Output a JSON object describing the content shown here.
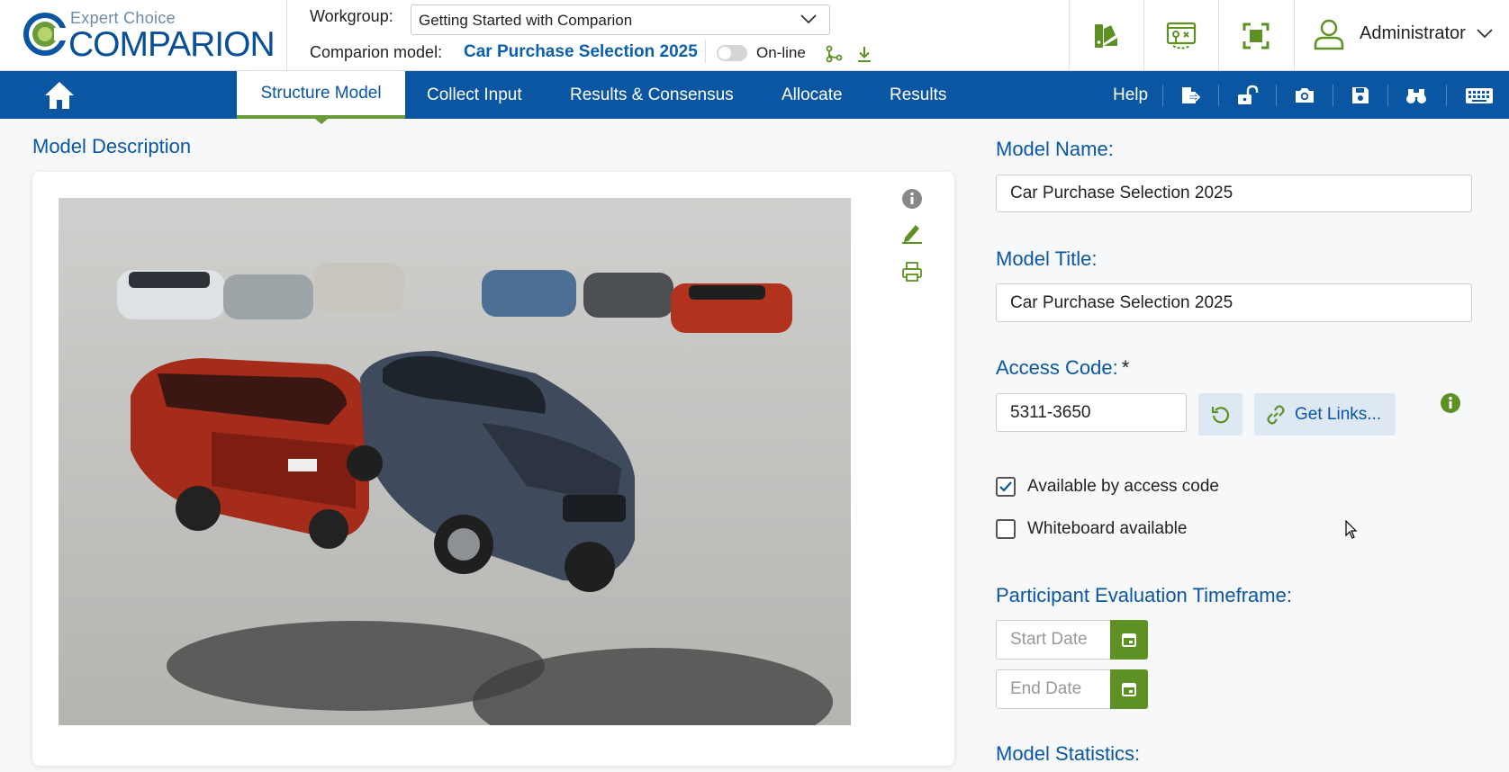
{
  "brand": {
    "small": "Expert Choice",
    "big": "COMPARION",
    "colors": {
      "primary": "#0a56a3",
      "accent_green": "#5e9123"
    }
  },
  "header": {
    "workgroup_label": "Workgroup:",
    "workgroup_value": "Getting Started with Comparion",
    "model_label": "Comparion model:",
    "model_name": "Car Purchase Selection 2025",
    "online_label": "On-line",
    "online_enabled": false,
    "toolbar_icons": [
      "palette-icon",
      "map-icon",
      "fullscreen-icon"
    ],
    "user_name": "Administrator"
  },
  "nav": {
    "tabs": [
      {
        "label": "Structure Model",
        "active": true
      },
      {
        "label": "Collect Input",
        "active": false
      },
      {
        "label": "Results & Consensus",
        "active": false
      },
      {
        "label": "Allocate",
        "active": false
      },
      {
        "label": "Results",
        "active": false
      }
    ],
    "help": "Help",
    "icons": [
      "export-icon",
      "unlock-icon",
      "camera-icon",
      "save-icon",
      "binoculars-icon",
      "keyboard-icon"
    ]
  },
  "description": {
    "title": "Model Description"
  },
  "form": {
    "model_name_label": "Model Name:",
    "model_name_value": "Car Purchase Selection 2025",
    "model_title_label": "Model Title:",
    "model_title_value": "Car Purchase Selection 2025",
    "access_code_label": "Access Code:",
    "access_code_required": "*",
    "access_code_value": "5311-3650",
    "get_links_label": "Get Links...",
    "available_by_code_label": "Available by access code",
    "available_by_code_checked": true,
    "whiteboard_label": "Whiteboard available",
    "whiteboard_checked": false,
    "timeframe_label": "Participant Evaluation Timeframe:",
    "start_date_placeholder": "Start Date",
    "end_date_placeholder": "End Date",
    "stats_label": "Model Statistics:"
  }
}
